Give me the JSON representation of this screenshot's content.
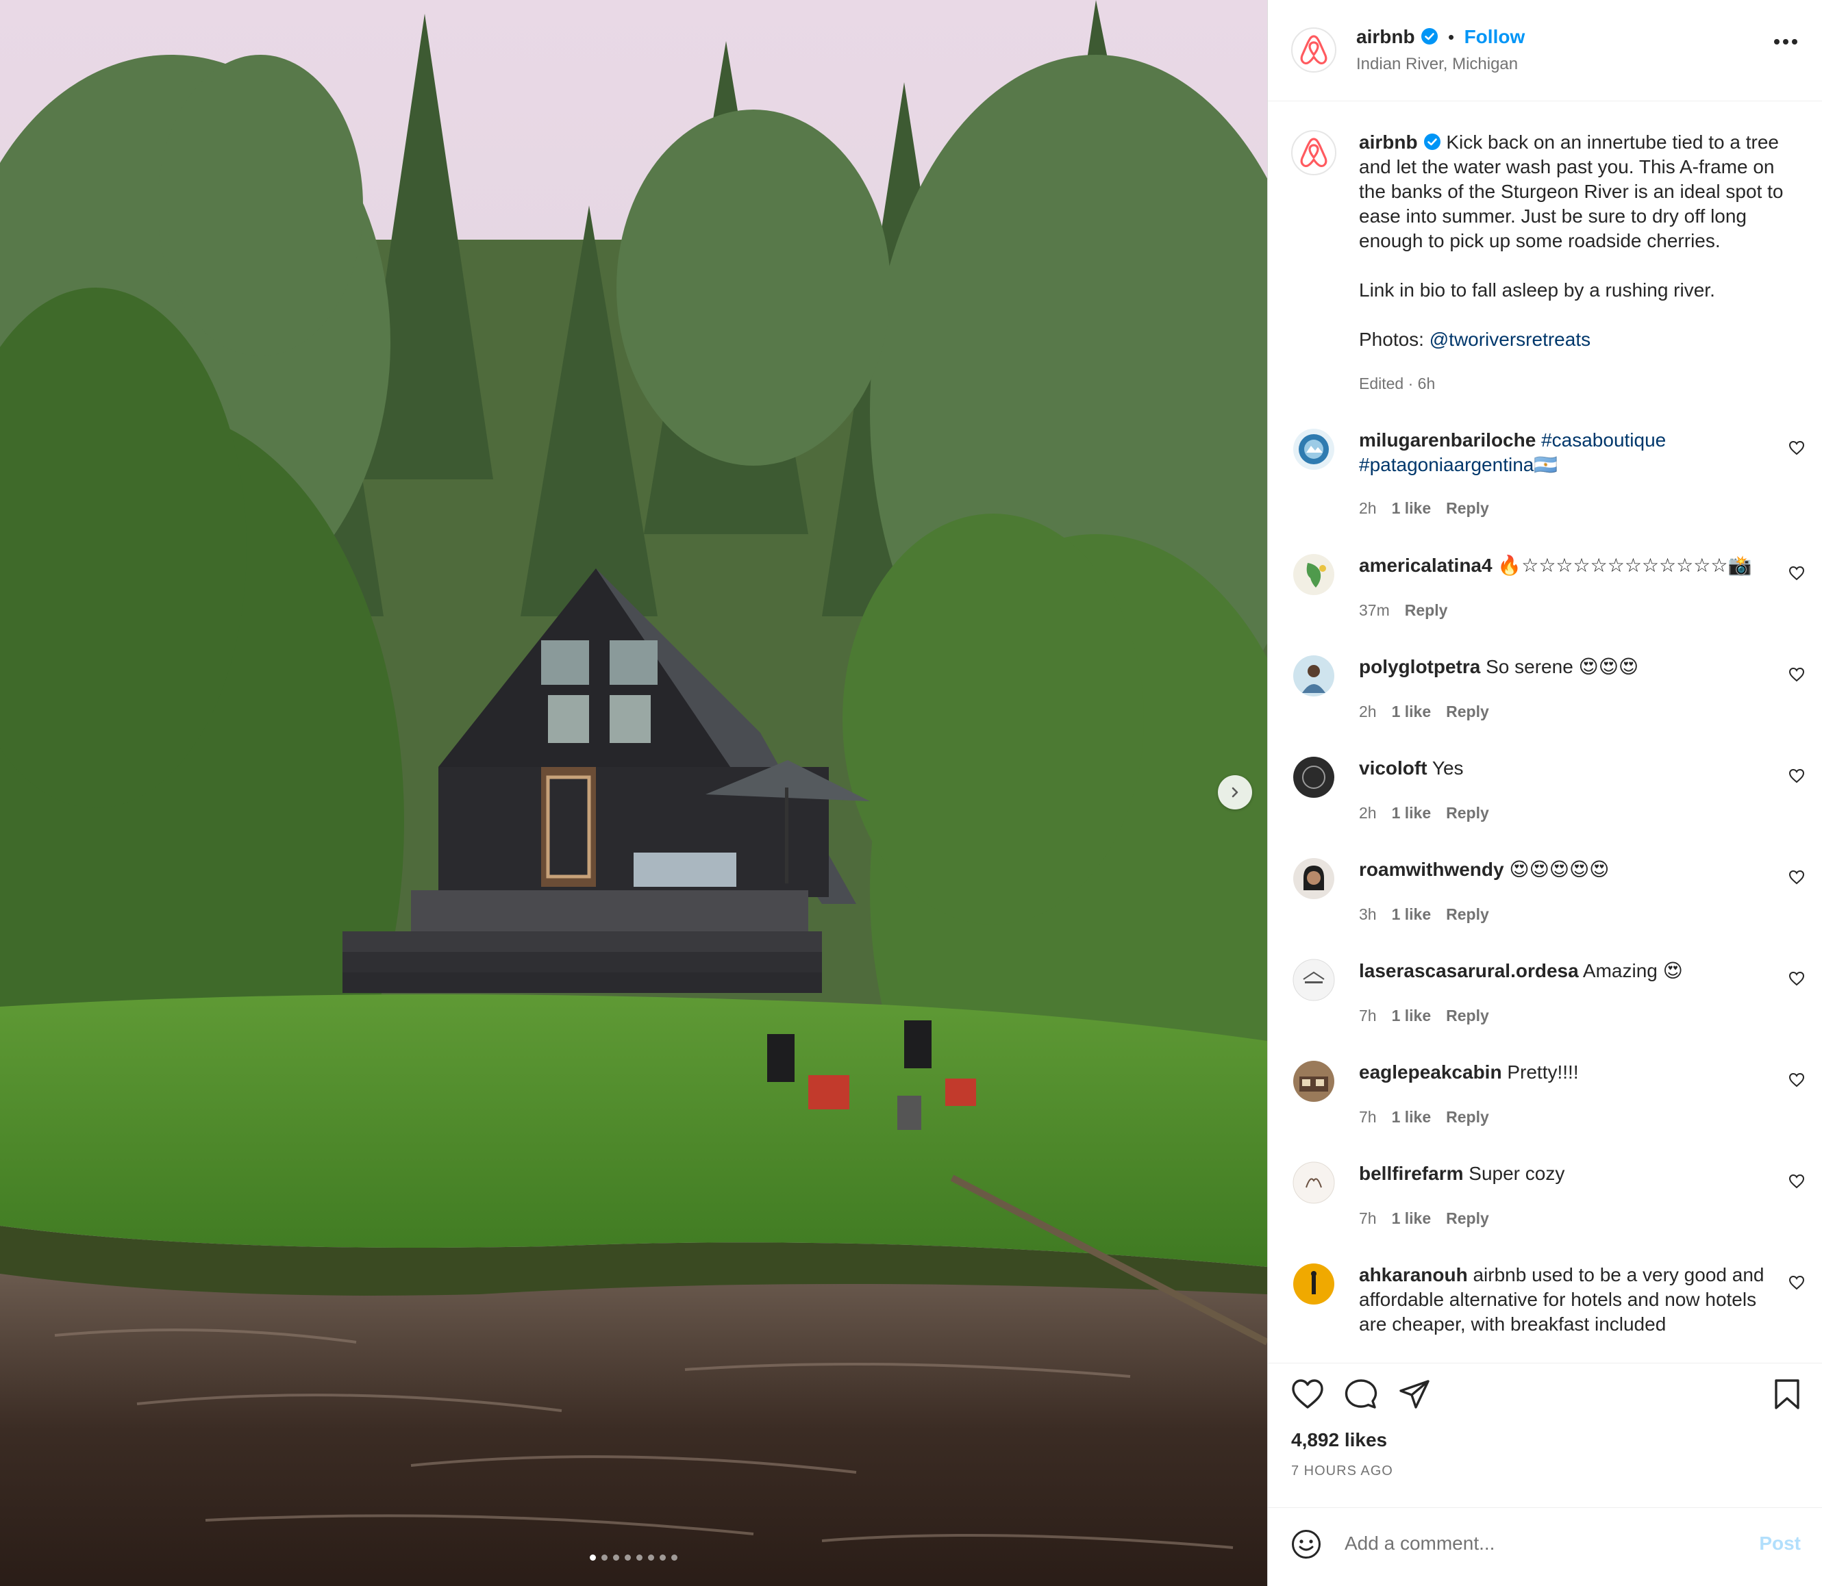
{
  "post": {
    "username": "airbnb",
    "dot": "•",
    "follow": "Follow",
    "location": "Indian River, Michigan",
    "caption_text": "Kick back on an innertube tied to a tree and let the water wash past you. This A-frame on the banks of the Sturgeon River is an ideal spot to ease into summer. Just be sure to dry off long enough to pick up some roadside cherries.",
    "caption_line2": "Link in bio to fall asleep by a rushing river.",
    "photos_label": "Photos:",
    "photos_handle": "@tworiversretreats",
    "edited": "Edited · 6h",
    "icons": {
      "more": "more-options-icon",
      "verified": "verified-badge-icon",
      "next": "chevron-right-icon"
    }
  },
  "comments": [
    {
      "user": "milugarenbariloche",
      "text": "#casaboutique #patagoniaargentina🇦🇷",
      "time": "2h",
      "likes": "1 like",
      "reply": "Reply"
    },
    {
      "user": "americalatina4",
      "text": "🔥☆☆☆☆☆☆☆☆☆☆☆☆📸",
      "time": "37m",
      "likes": "",
      "reply": "Reply"
    },
    {
      "user": "polyglotpetra",
      "text": "So serene 😍😍😍",
      "time": "2h",
      "likes": "1 like",
      "reply": "Reply"
    },
    {
      "user": "vicoloft",
      "text": "Yes",
      "time": "2h",
      "likes": "1 like",
      "reply": "Reply"
    },
    {
      "user": "roamwithwendy",
      "text": "😍😍😍😍😍",
      "time": "3h",
      "likes": "1 like",
      "reply": "Reply"
    },
    {
      "user": "laserascasarural.ordesa",
      "text": "Amazing 😍",
      "time": "7h",
      "likes": "1 like",
      "reply": "Reply"
    },
    {
      "user": "eaglepeakcabin",
      "text": "Pretty!!!!",
      "time": "7h",
      "likes": "1 like",
      "reply": "Reply"
    },
    {
      "user": "bellfirefarm",
      "text": "Super cozy",
      "time": "7h",
      "likes": "1 like",
      "reply": "Reply"
    },
    {
      "user": "ahkaranouh",
      "text": "airbnb used to be a very good and affordable alternative for hotels and now hotels are cheaper, with breakfast included",
      "time": "",
      "likes": "",
      "reply": ""
    }
  ],
  "actions": {
    "likes": "4,892 likes",
    "time": "7 HOURS AGO",
    "comment_placeholder": "Add a comment...",
    "post_button": "Post",
    "icons": [
      "heart-icon",
      "comment-icon",
      "share-icon",
      "bookmark-icon",
      "emoji-icon"
    ]
  },
  "carousel": {
    "count": 8,
    "active_index": 0
  },
  "colors": {
    "accent": "#0095f6",
    "brand": "#ff5a5f",
    "link": "#00376b",
    "secondary_text": "#737373"
  }
}
